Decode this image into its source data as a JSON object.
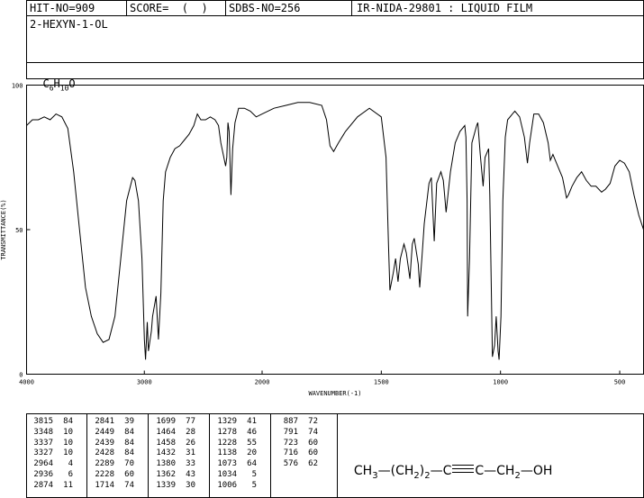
{
  "header": {
    "hit_no": "HIT-NO=909",
    "score": "SCORE=  (  )",
    "sdbs_no": "SDBS-NO=256",
    "ir_info": "IR-NIDA-29801 : LIQUID FILM",
    "compound_name": "2-HEXYN-1-OL",
    "formula_main": "C",
    "formula_parts": [
      {
        "text": "C",
        "sub": "6"
      },
      {
        "text": "H",
        "sub": "10"
      },
      {
        "text": "O",
        "sub": ""
      }
    ]
  },
  "chart_data": {
    "type": "line",
    "xlabel": "WAVENUMBER(-1)",
    "ylabel": "TRANSMITTANCE(%)",
    "xlim": [
      4000,
      400
    ],
    "ylim": [
      0,
      100
    ],
    "x_ticks": [
      "4000",
      "3000",
      "2000",
      "1500",
      "1000",
      "500"
    ],
    "x_tick_values": [
      4000,
      3000,
      2000,
      1500,
      1000,
      500
    ],
    "y_ticks": [
      "100",
      "50",
      "0"
    ],
    "y_tick_values": [
      100,
      50,
      0
    ],
    "series": [
      {
        "points": [
          [
            4000,
            86
          ],
          [
            3950,
            88
          ],
          [
            3900,
            88
          ],
          [
            3850,
            89
          ],
          [
            3800,
            88
          ],
          [
            3750,
            90
          ],
          [
            3700,
            89
          ],
          [
            3650,
            85
          ],
          [
            3600,
            70
          ],
          [
            3550,
            50
          ],
          [
            3500,
            30
          ],
          [
            3450,
            20
          ],
          [
            3400,
            14
          ],
          [
            3350,
            11
          ],
          [
            3300,
            12
          ],
          [
            3250,
            20
          ],
          [
            3200,
            40
          ],
          [
            3150,
            60
          ],
          [
            3100,
            68
          ],
          [
            3080,
            67
          ],
          [
            3050,
            60
          ],
          [
            3020,
            40
          ],
          [
            3000,
            12
          ],
          [
            2990,
            5
          ],
          [
            2975,
            18
          ],
          [
            2965,
            8
          ],
          [
            2940,
            15
          ],
          [
            2930,
            20
          ],
          [
            2900,
            27
          ],
          [
            2880,
            12
          ],
          [
            2860,
            28
          ],
          [
            2840,
            60
          ],
          [
            2820,
            70
          ],
          [
            2780,
            75
          ],
          [
            2740,
            78
          ],
          [
            2700,
            79
          ],
          [
            2660,
            81
          ],
          [
            2620,
            83
          ],
          [
            2580,
            86
          ],
          [
            2550,
            90
          ],
          [
            2520,
            88
          ],
          [
            2480,
            88
          ],
          [
            2440,
            89
          ],
          [
            2400,
            88
          ],
          [
            2370,
            86
          ],
          [
            2350,
            80
          ],
          [
            2310,
            72
          ],
          [
            2300,
            75
          ],
          [
            2290,
            87
          ],
          [
            2280,
            84
          ],
          [
            2265,
            62
          ],
          [
            2250,
            78
          ],
          [
            2230,
            87
          ],
          [
            2200,
            92
          ],
          [
            2150,
            92
          ],
          [
            2100,
            91
          ],
          [
            2050,
            89
          ],
          [
            2000,
            90
          ],
          [
            1950,
            92
          ],
          [
            1900,
            93
          ],
          [
            1850,
            94
          ],
          [
            1800,
            94
          ],
          [
            1750,
            93
          ],
          [
            1730,
            88
          ],
          [
            1715,
            79
          ],
          [
            1700,
            77
          ],
          [
            1680,
            80
          ],
          [
            1650,
            84
          ],
          [
            1600,
            89
          ],
          [
            1550,
            92
          ],
          [
            1500,
            89
          ],
          [
            1480,
            75
          ],
          [
            1470,
            45
          ],
          [
            1464,
            29
          ],
          [
            1450,
            35
          ],
          [
            1440,
            40
          ],
          [
            1430,
            32
          ],
          [
            1420,
            40
          ],
          [
            1405,
            45
          ],
          [
            1395,
            42
          ],
          [
            1380,
            33
          ],
          [
            1370,
            45
          ],
          [
            1362,
            47
          ],
          [
            1345,
            38
          ],
          [
            1339,
            30
          ],
          [
            1329,
            41
          ],
          [
            1320,
            52
          ],
          [
            1300,
            66
          ],
          [
            1290,
            68
          ],
          [
            1278,
            46
          ],
          [
            1268,
            66
          ],
          [
            1250,
            70
          ],
          [
            1240,
            67
          ],
          [
            1228,
            56
          ],
          [
            1210,
            70
          ],
          [
            1190,
            80
          ],
          [
            1170,
            84
          ],
          [
            1150,
            86
          ],
          [
            1145,
            82
          ],
          [
            1140,
            60
          ],
          [
            1138,
            20
          ],
          [
            1130,
            40
          ],
          [
            1120,
            80
          ],
          [
            1100,
            86
          ],
          [
            1095,
            87
          ],
          [
            1085,
            76
          ],
          [
            1073,
            65
          ],
          [
            1065,
            75
          ],
          [
            1050,
            78
          ],
          [
            1045,
            62
          ],
          [
            1034,
            6
          ],
          [
            1025,
            10
          ],
          [
            1018,
            20
          ],
          [
            1010,
            8
          ],
          [
            1006,
            5
          ],
          [
            998,
            20
          ],
          [
            990,
            60
          ],
          [
            980,
            82
          ],
          [
            970,
            88
          ],
          [
            950,
            90
          ],
          [
            940,
            91
          ],
          [
            920,
            89
          ],
          [
            900,
            82
          ],
          [
            887,
            73
          ],
          [
            878,
            80
          ],
          [
            860,
            90
          ],
          [
            840,
            90
          ],
          [
            820,
            87
          ],
          [
            800,
            80
          ],
          [
            791,
            74
          ],
          [
            780,
            76
          ],
          [
            760,
            72
          ],
          [
            740,
            68
          ],
          [
            723,
            61
          ],
          [
            715,
            62
          ],
          [
            700,
            65
          ],
          [
            680,
            68
          ],
          [
            660,
            70
          ],
          [
            640,
            67
          ],
          [
            620,
            65
          ],
          [
            600,
            65
          ],
          [
            576,
            63
          ],
          [
            560,
            64
          ],
          [
            540,
            66
          ],
          [
            520,
            72
          ],
          [
            500,
            74
          ],
          [
            480,
            73
          ],
          [
            460,
            70
          ],
          [
            440,
            62
          ],
          [
            420,
            55
          ],
          [
            400,
            50
          ]
        ]
      }
    ]
  },
  "peak_table": {
    "columns": [
      [
        [
          "3815",
          "84"
        ],
        [
          "3348",
          "10"
        ],
        [
          "3337",
          "10"
        ],
        [
          "3327",
          "10"
        ],
        [
          "2964",
          "4"
        ],
        [
          "2936",
          "6"
        ],
        [
          "2874",
          "11"
        ]
      ],
      [
        [
          "2841",
          "39"
        ],
        [
          "2449",
          "84"
        ],
        [
          "2439",
          "84"
        ],
        [
          "2428",
          "84"
        ],
        [
          "2289",
          "70"
        ],
        [
          "2228",
          "60"
        ],
        [
          "1714",
          "74"
        ]
      ],
      [
        [
          "1699",
          "77"
        ],
        [
          "1464",
          "28"
        ],
        [
          "1458",
          "26"
        ],
        [
          "1432",
          "31"
        ],
        [
          "1380",
          "33"
        ],
        [
          "1362",
          "43"
        ],
        [
          "1339",
          "30"
        ]
      ],
      [
        [
          "1329",
          "41"
        ],
        [
          "1278",
          "46"
        ],
        [
          "1228",
          "55"
        ],
        [
          "1138",
          "20"
        ],
        [
          "1073",
          "64"
        ],
        [
          "1034",
          "5"
        ],
        [
          "1006",
          "5"
        ]
      ],
      [
        [
          "887",
          "72"
        ],
        [
          "791",
          "74"
        ],
        [
          "723",
          "60"
        ],
        [
          "716",
          "60"
        ],
        [
          "576",
          "62"
        ]
      ]
    ]
  },
  "structure": {
    "ch3": "CH",
    "ch3_sub": "3",
    "dash1": "—",
    "open": "(",
    "ch2a": "CH",
    "ch2a_sub": "2",
    "close": ")",
    "close_sub": "2",
    "dash2": "—",
    "c1": "C",
    "c2": "C",
    "dash3": "—",
    "ch2b": "CH",
    "ch2b_sub": "2",
    "dash4": "—",
    "oh": "OH"
  }
}
